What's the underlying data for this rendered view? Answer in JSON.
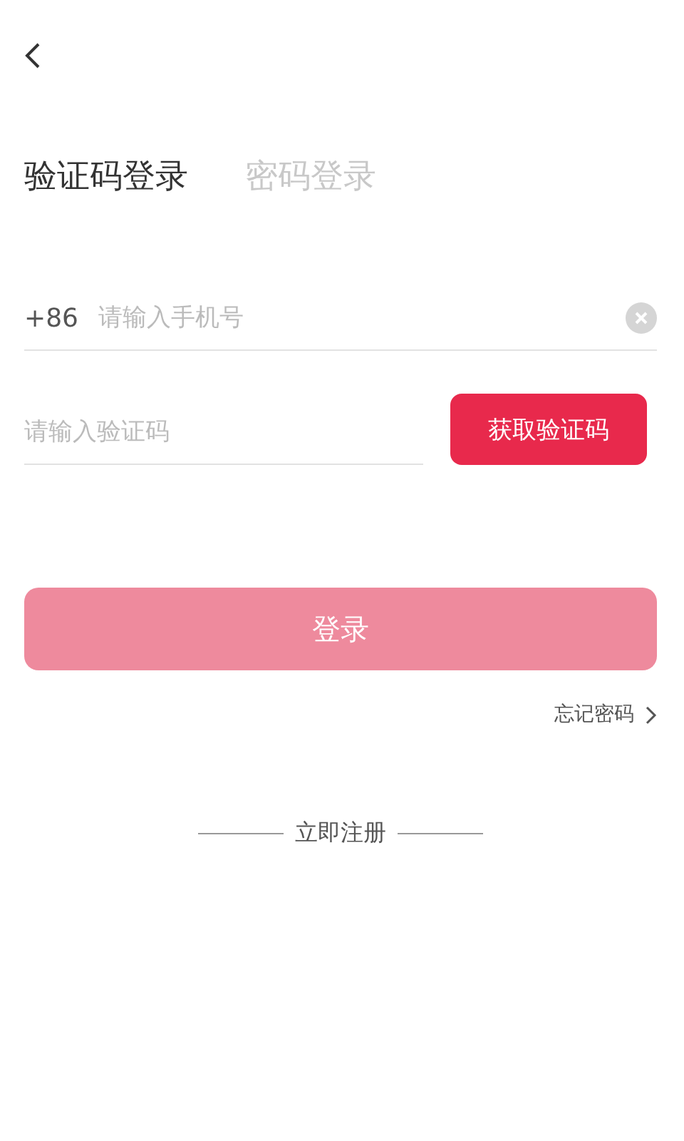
{
  "tabs": [
    {
      "label": "验证码登录",
      "selected": true
    },
    {
      "label": "密码登录",
      "selected": false
    }
  ],
  "phone": {
    "country_code": "+86",
    "placeholder": "请输入手机号"
  },
  "code": {
    "placeholder": "请输入验证码",
    "button": "获取验证码"
  },
  "login_button": {
    "label": "登录",
    "disabled": true
  },
  "forgot_link": "忘记密码",
  "register_link": "立即注册"
}
